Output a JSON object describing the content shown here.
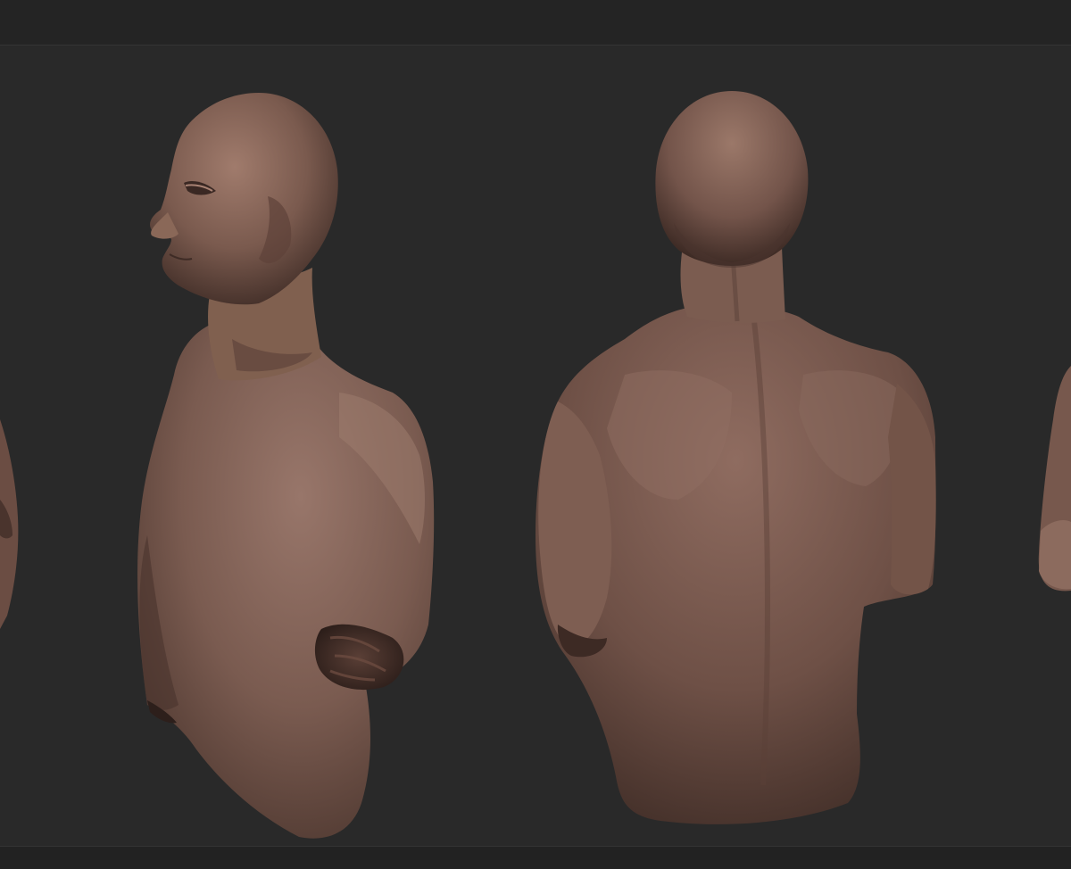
{
  "scene": {
    "subject": "sculpt-bust-turnaround",
    "views": [
      "left-profile-view",
      "back-view"
    ],
    "partial_views": [
      "edge-view-left",
      "edge-view-right"
    ],
    "colors": {
      "background": "#292929",
      "skin_light": "#9a7466",
      "skin_mid": "#74554a",
      "skin_dark": "#3e2b25"
    }
  }
}
